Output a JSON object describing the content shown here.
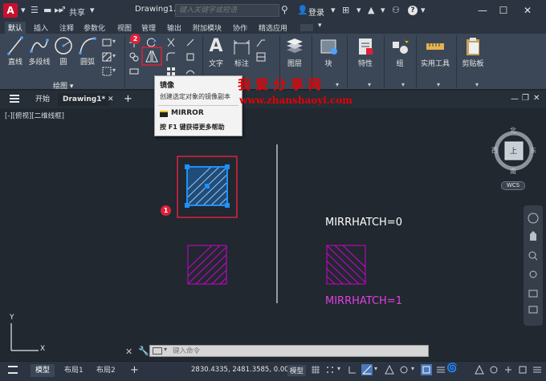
{
  "titlebar": {
    "logo": "A",
    "share_label": "共享",
    "doc_title": "Drawing1.dwg",
    "search_placeholder": "键入关键字或短语",
    "login_label": "登录",
    "help_label": "?"
  },
  "ribbon_tabs": [
    "默认",
    "插入",
    "注释",
    "参数化",
    "视图",
    "管理",
    "输出",
    "附加模块",
    "协作",
    "精选应用"
  ],
  "ribbon": {
    "draw_tools": [
      {
        "label": "直线",
        "icon": "line-icon"
      },
      {
        "label": "多段线",
        "icon": "polyline-icon"
      },
      {
        "label": "圆",
        "icon": "circle-icon"
      },
      {
        "label": "圆弧",
        "icon": "arc-icon"
      }
    ],
    "draw_panel_title": "绘图",
    "text_label": "文字",
    "dim_label": "标注",
    "layer_label": "图层",
    "block_label": "块",
    "props_label": "特性",
    "group_label": "组",
    "utils_label": "实用工具",
    "clipboard_label": "剪贴板"
  },
  "doc_tabs": {
    "start": "开始",
    "drawing": "Drawing1*",
    "add": "+"
  },
  "viewport": {
    "label": "[-][俯视][二维线框]",
    "mirrhatch0": "MIRRHATCH=0",
    "mirrhatch1": "MIRRHATCH=1",
    "badge1": "1",
    "badge2": "2"
  },
  "tooltip": {
    "title": "镜像",
    "desc": "创建选定对象的镜像副本",
    "command": "MIRROR",
    "help": "按 F1 键获得更多帮助"
  },
  "watermark": {
    "cn": "我爱分享网",
    "url": "www.zhanshaoyi.com"
  },
  "viewcube": {
    "north": "北",
    "south": "南",
    "east": "东",
    "west": "西",
    "top": "上",
    "wcs": "WCS"
  },
  "ucs": {
    "x": "X",
    "y": "Y"
  },
  "cmdline": {
    "placeholder": "键入命令"
  },
  "statusbar": {
    "model_tab": "模型",
    "layout1": "布局1",
    "layout2": "布局2",
    "add": "+",
    "coords": "2830.4335, 2481.3585, 0.0000",
    "model_status": "模型"
  },
  "colors": {
    "accent_blue": "#1e90ff",
    "highlight_red": "#e0203a",
    "magenta": "#d000d0",
    "watermark": "#e60000"
  }
}
